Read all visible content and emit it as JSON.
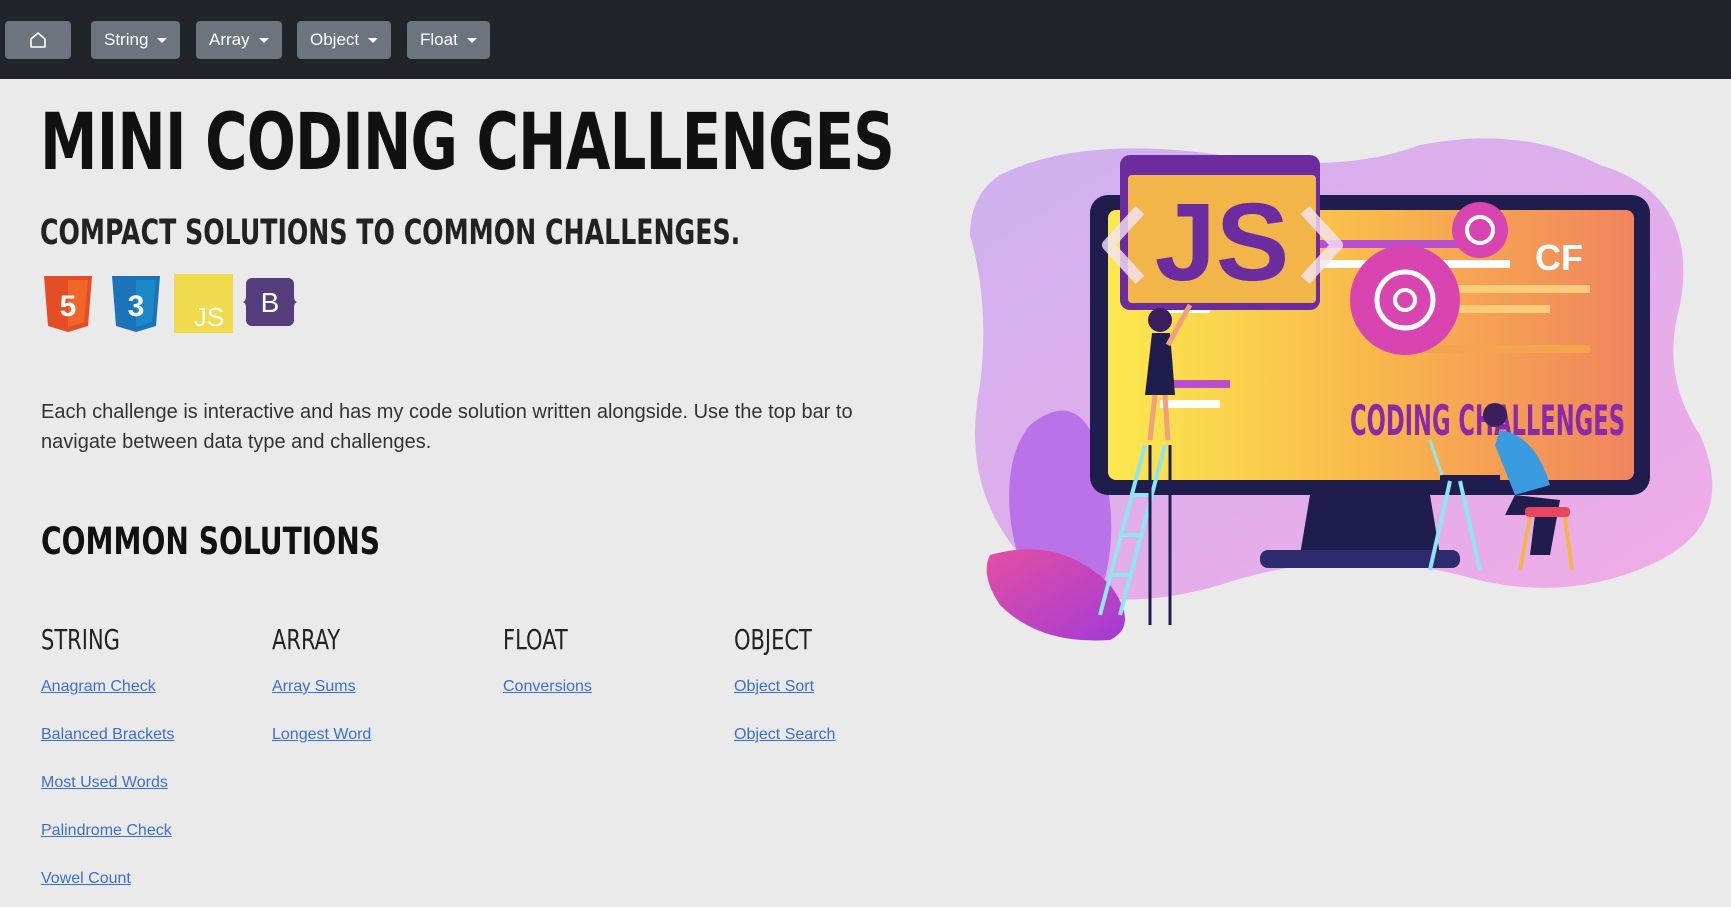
{
  "nav": {
    "home_icon": "home-icon",
    "menus": [
      {
        "label": "String"
      },
      {
        "label": "Array"
      },
      {
        "label": "Object"
      },
      {
        "label": "Float"
      }
    ]
  },
  "header": {
    "title": "MINI CODING CHALLENGES",
    "subtitle": "COMPACT SOLUTIONS TO COMMON CHALLENGES.",
    "tech_icons": [
      {
        "name": "html5-icon",
        "glyph": "5",
        "color": "#e44d26"
      },
      {
        "name": "css3-icon",
        "glyph": "3",
        "color": "#1b73ba"
      },
      {
        "name": "javascript-icon",
        "glyph": "JS",
        "color": "#f0db4f"
      },
      {
        "name": "bootstrap-icon",
        "glyph": "B",
        "color": "#563d7c"
      }
    ]
  },
  "intro": "Each challenge is interactive and has my code solution written alongside. Use the top bar to navigate between data type and challenges.",
  "solutions": {
    "title": "COMMON SOLUTIONS",
    "columns": [
      {
        "title": "STRING",
        "links": [
          "Anagram Check",
          "Balanced Brackets",
          "Most Used Words",
          "Palindrome Check",
          "Vowel Count"
        ]
      },
      {
        "title": "ARRAY",
        "links": [
          "Array Sums",
          "Longest Word"
        ]
      },
      {
        "title": "FLOAT",
        "links": [
          "Conversions"
        ]
      },
      {
        "title": "OBJECT",
        "links": [
          "Object Sort",
          "Object Search"
        ]
      }
    ]
  },
  "hero": {
    "badge_text": "JS",
    "logo_text": "CF",
    "screen_text": "CODING CHALLENGES"
  },
  "colors": {
    "navbar": "#212529",
    "nav_button": "#6c757d",
    "link": "#3b6fd8",
    "background": "#ebeaea"
  }
}
